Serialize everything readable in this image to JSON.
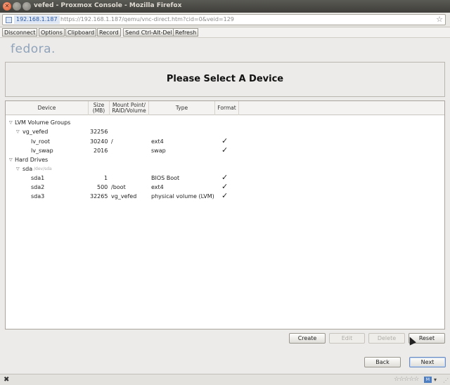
{
  "window": {
    "title": "vefed - Proxmox Console - Mozilla Firefox"
  },
  "urlbar": {
    "domain": "192.168.1.187",
    "path": "https://192.168.1.187/qemu/vnc-direct.htm?cid=0&veid=129"
  },
  "vnc_toolbar": {
    "buttons": [
      "Disconnect",
      "Options",
      "Clipboard",
      "Record",
      "Send Ctrl-Alt-Del",
      "Refresh"
    ]
  },
  "installer": {
    "logo": "fedora.",
    "title": "Please Select A Device",
    "columns": {
      "device": "Device",
      "size": "Size (MB)",
      "mount": "Mount Point/ RAID/Volume",
      "type": "Type",
      "format": "Format"
    },
    "rows": [
      {
        "device": "LVM Volume Groups",
        "size": "",
        "mount": "",
        "type": "",
        "format": false,
        "level": 0,
        "expander": true
      },
      {
        "device": "vg_vefed",
        "size": "32256",
        "mount": "",
        "type": "",
        "format": false,
        "level": 1,
        "expander": true
      },
      {
        "device": "lv_root",
        "size": "30240",
        "mount": "/",
        "type": "ext4",
        "format": true,
        "level": 2,
        "expander": false
      },
      {
        "device": "lv_swap",
        "size": "2016",
        "mount": "",
        "type": "swap",
        "format": true,
        "level": 2,
        "expander": false
      },
      {
        "device": "Hard Drives",
        "size": "",
        "mount": "",
        "type": "",
        "format": false,
        "level": 0,
        "expander": true
      },
      {
        "device": "sda",
        "sub": "/dev/sda",
        "size": "",
        "mount": "",
        "type": "",
        "format": false,
        "level": 1,
        "expander": true
      },
      {
        "device": "sda1",
        "size": "1",
        "mount": "",
        "type": "BIOS Boot",
        "format": true,
        "level": 2,
        "expander": false
      },
      {
        "device": "sda2",
        "size": "500",
        "mount": "/boot",
        "type": "ext4",
        "format": true,
        "level": 2,
        "expander": false
      },
      {
        "device": "sda3",
        "size": "32265",
        "mount": "vg_vefed",
        "type": "physical volume (LVM)",
        "format": true,
        "level": 2,
        "expander": false
      }
    ],
    "actions": {
      "create": "Create",
      "edit": "Edit",
      "delete": "Delete",
      "reset": "Reset"
    },
    "nav": {
      "back": "Back",
      "next": "Next"
    }
  },
  "icons": {
    "close": "close-icon",
    "star": "star-icon",
    "checkmark": "checkmark-icon",
    "expander": "triangle-down-icon"
  }
}
